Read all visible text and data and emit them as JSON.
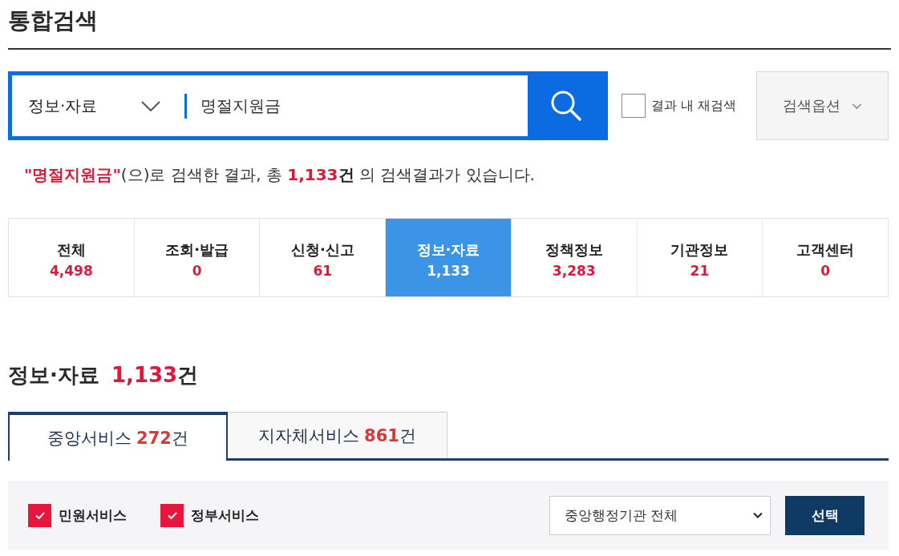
{
  "page_title": "통합검색",
  "search": {
    "scope": "정보·자료",
    "query": "명절지원금",
    "refine": {
      "label": "결과 내 재검색",
      "checked": false
    },
    "options_button": "검색옵션"
  },
  "summary": [
    {
      "kind": "highlight",
      "text": "\"명절지원금\""
    },
    {
      "kind": "plain",
      "text": "(으)로 검색한 결과, 총 "
    },
    {
      "kind": "highlight",
      "text": "1,133"
    },
    {
      "kind": "strong",
      "text": "건"
    },
    {
      "kind": "plain",
      "text": " 의 검색결과가 있습니다."
    }
  ],
  "categories": [
    {
      "label": "전체",
      "count": "4,498",
      "selected": false
    },
    {
      "label": "조회·발급",
      "count": "0",
      "selected": false
    },
    {
      "label": "신청·신고",
      "count": "61",
      "selected": false
    },
    {
      "label": "정보·자료",
      "count": "1,133",
      "selected": true
    },
    {
      "label": "정책정보",
      "count": "3,283",
      "selected": false
    },
    {
      "label": "기관정보",
      "count": "21",
      "selected": false
    },
    {
      "label": "고객센터",
      "count": "0",
      "selected": false
    }
  ],
  "section": {
    "title": "정보·자료",
    "count": "1,133",
    "unit": "건"
  },
  "tabs": [
    {
      "label": "중앙서비스",
      "count": "272",
      "unit": "건",
      "selected": true
    },
    {
      "label": "지자체서비스",
      "count": "861",
      "unit": "건",
      "selected": false
    }
  ],
  "filters": {
    "checkboxes": [
      {
        "label": "민원서비스",
        "checked": true
      },
      {
        "label": "정부서비스",
        "checked": true
      }
    ],
    "agency_select": "중앙행정기관 전체",
    "apply_button": "선택"
  }
}
